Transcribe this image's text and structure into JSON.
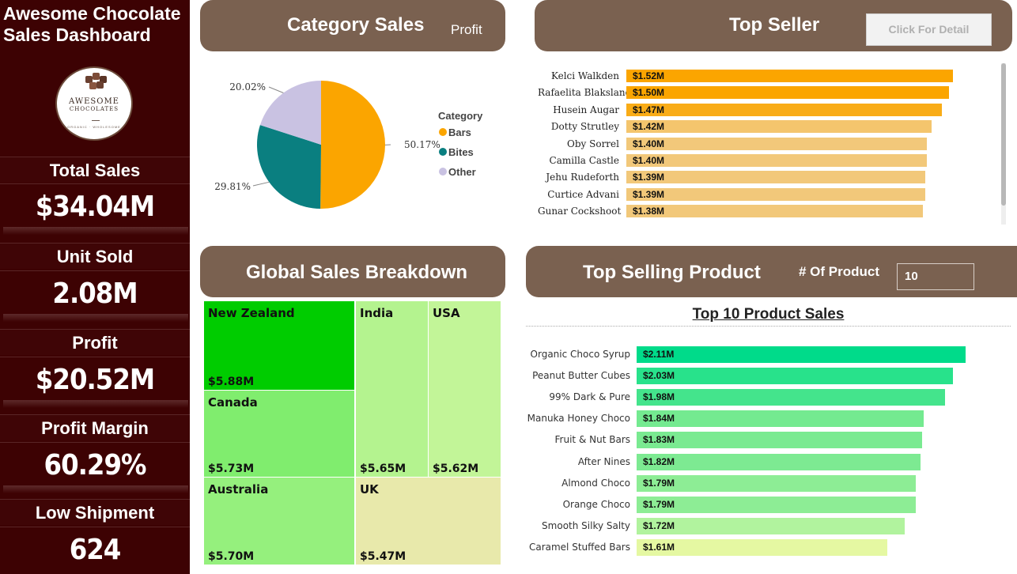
{
  "sidebar": {
    "title": "Awesome Chocolate\nSales Dashboard",
    "logo": {
      "line1": "AWESOME",
      "line2": "CHOCOLATES",
      "tagline": "ORGANIC · WHOLESOME"
    },
    "kpis": [
      {
        "label": "Total Sales",
        "value": "$34.04M"
      },
      {
        "label": "Unit Sold",
        "value": "2.08M"
      },
      {
        "label": "Profit",
        "value": "$20.52M"
      },
      {
        "label": "Profit Margin",
        "value": "60.29%"
      },
      {
        "label": "Low Shipment",
        "value": "624"
      }
    ]
  },
  "category_panel": {
    "title": "Category Sales",
    "toggle_label": "Profit"
  },
  "top_seller_panel": {
    "title": "Top Seller",
    "detail_button": "Click For Detail"
  },
  "global_panel": {
    "title": "Global Sales Breakdown"
  },
  "product_panel": {
    "title": "Top Selling Product",
    "count_label": "# Of Product",
    "count_value": "10",
    "chart_title": "Top 10 Product Sales"
  },
  "colors": {
    "sidebar_bg": "#3d0203",
    "header_bg": "#7a6150",
    "bars": "#fba500",
    "bites": "#0a7f80",
    "other": "#c9c2e2"
  },
  "chart_data": [
    {
      "type": "pie",
      "legend_title": "Category",
      "legend_position": "right",
      "slices": [
        {
          "label": "Bars",
          "value": 50.17,
          "display": "50.17%",
          "color": "#fba500"
        },
        {
          "label": "Bites",
          "value": 29.81,
          "display": "29.81%",
          "color": "#0a7f80"
        },
        {
          "label": "Other",
          "value": 20.02,
          "display": "20.02%",
          "color": "#c9c2e2"
        }
      ]
    },
    {
      "type": "bar",
      "orientation": "horizontal",
      "categories": [
        "Kelci Walkden",
        "Rafaelita Blaksland",
        "Husein Augar",
        "Dotty Strutley",
        "Oby Sorrel",
        "Camilla Castle",
        "Jehu Rudeforth",
        "Curtice Advani",
        "Gunar Cockshoot"
      ],
      "values": [
        1.52,
        1.5,
        1.47,
        1.42,
        1.4,
        1.4,
        1.39,
        1.39,
        1.38
      ],
      "labels": [
        "$1.52M",
        "$1.50M",
        "$1.47M",
        "$1.42M",
        "$1.40M",
        "$1.40M",
        "$1.39M",
        "$1.39M",
        "$1.38M"
      ],
      "colors": [
        "#fba500",
        "#fba500",
        "#f9ac17",
        "#f4c56d",
        "#f2c87a",
        "#f2c87a",
        "#f2c87a",
        "#f2c87a",
        "#f2c87a"
      ]
    },
    {
      "type": "heatmap",
      "kind": "treemap",
      "items": [
        {
          "label": "New Zealand",
          "value": 5.88,
          "display": "$5.88M",
          "color": "#00cc00"
        },
        {
          "label": "Canada",
          "value": 5.73,
          "display": "$5.73M",
          "color": "#80ed6e"
        },
        {
          "label": "Australia",
          "value": 5.7,
          "display": "$5.70M",
          "color": "#95f07d"
        },
        {
          "label": "India",
          "value": 5.65,
          "display": "$5.65M",
          "color": "#b4f38f"
        },
        {
          "label": "USA",
          "value": 5.62,
          "display": "$5.62M",
          "color": "#c2f598"
        },
        {
          "label": "UK",
          "value": 5.47,
          "display": "$5.47M",
          "color": "#e8e9ab"
        }
      ]
    },
    {
      "type": "bar",
      "orientation": "horizontal",
      "title": "Top 10 Product Sales",
      "categories": [
        "Organic Choco Syrup",
        "Peanut Butter Cubes",
        "99% Dark & Pure",
        "Manuka Honey Choco",
        "Fruit & Nut Bars",
        "After Nines",
        "Almond Choco",
        "Orange Choco",
        "Smooth Silky Salty",
        "Caramel Stuffed Bars"
      ],
      "values": [
        2.11,
        2.03,
        1.98,
        1.84,
        1.83,
        1.82,
        1.79,
        1.79,
        1.72,
        1.61
      ],
      "labels": [
        "$2.11M",
        "$2.03M",
        "$1.98M",
        "$1.84M",
        "$1.83M",
        "$1.82M",
        "$1.79M",
        "$1.79M",
        "$1.72M",
        "$1.61M"
      ],
      "colors": [
        "#00db8a",
        "#28e28b",
        "#44e48c",
        "#74ea90",
        "#7aea91",
        "#7dea92",
        "#8ded95",
        "#8ded95",
        "#b1f39e",
        "#e5f8a2"
      ]
    }
  ]
}
